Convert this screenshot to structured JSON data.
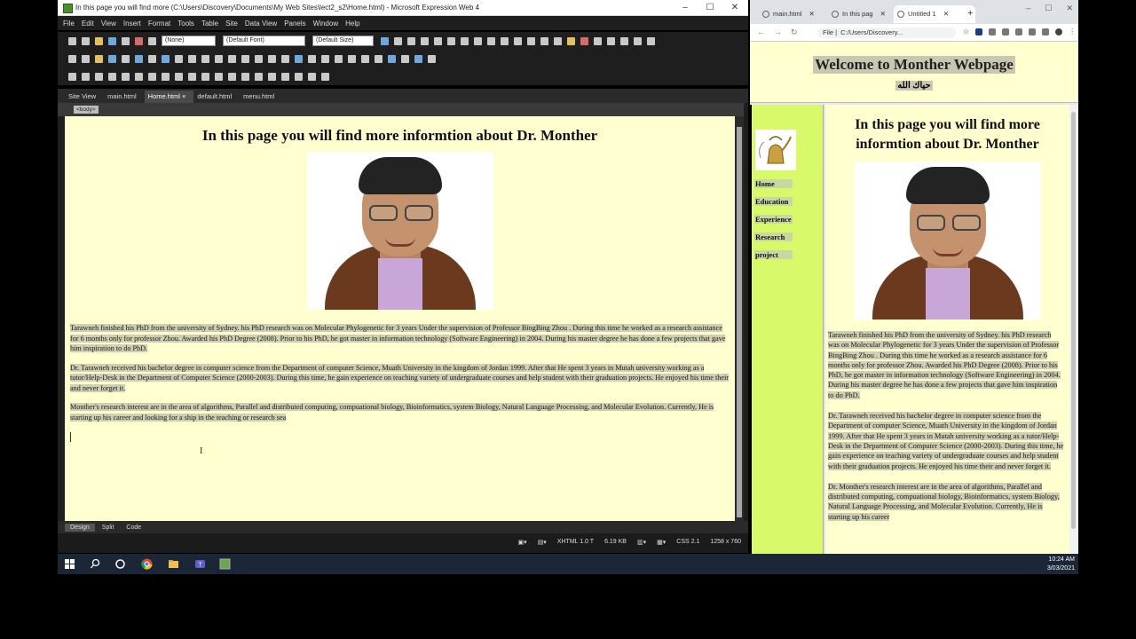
{
  "expression_web": {
    "title": "In this page you will find more (C:\\Users\\Discovery\\Documents\\My Web Sites\\lect2_s2\\Home.html) - Microsoft Expression Web 4",
    "window_controls": [
      "–",
      "☐",
      "✕"
    ],
    "menu": [
      "File",
      "Edit",
      "View",
      "Insert",
      "Format",
      "Tools",
      "Table",
      "Site",
      "Data View",
      "Panels",
      "Window",
      "Help"
    ],
    "toolbar": {
      "style_select": "(None)",
      "font_select": "(Default Font)",
      "size_select": "(Default Size)"
    },
    "tabs": [
      {
        "label": "Site View",
        "active": false
      },
      {
        "label": "main.html",
        "active": false
      },
      {
        "label": "Home.html ×",
        "active": true
      },
      {
        "label": "default.html",
        "active": false
      },
      {
        "label": "menu.html",
        "active": false
      }
    ],
    "breadcrumb_tag": "<body>",
    "document": {
      "heading": "In this page you will find more informtion about Dr. Monther",
      "paragraphs": [
        "Tarawneh finished his PhD from the university of Sydney. his PhD research was on Molecular Phylogenetic for 3 years Under the supervision of Professor BingBing Zhou . During this time he worked as a research assistance for 6 months only for professor Zhou. Awarded his PhD Degree (2008). Prior to his PhD, he got master in information technology (Software Engineering) in 2004. During his master degree he has done a few projects that gave him inspiration to do PhD.",
        "Dr. Tarawneh received his bachelor degree in computer science from the Department of computer Science, Muath University in the kingdom of Jordan 1999. After that He spent 3 years in Mutah university working as a tutor/Help-Desk in the Department of Computer Science (2000-2003). During this time, he gain experience on teaching variety of undergraduate courses and help student with their graduation projects. He enjoyed his time their and never forget it.",
        "Monther's research interest are in the area of algorithms, Parallel and distributed computing, compuational biology, Bioinformatics, system Biology, Natural Language Processing, and Molecular Evolution.  Currently, He is starting up his career and looking for a ship in the teaching or research sea"
      ]
    },
    "view_tabs": [
      {
        "label": "Design",
        "active": true
      },
      {
        "label": "Split",
        "active": false
      },
      {
        "label": "Code",
        "active": false
      }
    ],
    "status": {
      "doctype": "XHTML 1.0 T",
      "size": "6.19 KB",
      "css": "CSS 2.1",
      "dimensions": "1258 x 760"
    }
  },
  "chrome": {
    "tabs": [
      {
        "label": "main.html",
        "active": false
      },
      {
        "label": "In this pag",
        "active": false
      },
      {
        "label": "Untitled 1",
        "active": true
      }
    ],
    "new_tab": "+",
    "window_controls": [
      "–",
      "☐",
      "✕"
    ],
    "address": "C:/Users/Discovery...",
    "address_scheme": "File",
    "page": {
      "welcome": "Welcome to Monther Webpage",
      "arabic": "حياك الله",
      "nav_links": [
        "Home",
        "Education",
        "Experience",
        "Research",
        "project"
      ],
      "heading": "In this page you will find more informtion about Dr. Monther",
      "paragraphs": [
        "Tarawneh finished his PhD from the university of Sydney. his PhD research was on Molecular Phylogenetic for 3 years Under the supervision of Professor BingBing Zhou . During this time he worked as a research assistance for 6 months only for professor Zhou. Awarded his PhD Degree (2008). Prior to his PhD, he got master in information technology (Software Engineering) in 2004. During his master degree he has done a few projects that gave him inspiration to do PhD.",
        "Dr. Tarawneh received his bachelor degree in computer science from the Department of computer Science, Muath University in the kingdom of Jordan 1999. After that He spent 3 years in Mutah university working as a tutor/Help-Desk in the Department of Computer Science (2000-2003). During this time, he gain experience on teaching variety of undergraduate courses and help student with their graduation projects. He enjoyed his time their and never forget it.",
        "Dr. Monther's research interest are in the area of algorithms, Parallel and distributed computing, compuational biology, Bioinformatics, system Biology, Natural Language Processing, and Molecular Evolution.  Currently, He is starting up his career"
      ]
    }
  },
  "taskbar": {
    "time": "10:24 AM",
    "date": "3/03/2021"
  },
  "colors": {
    "page_bg": "#ffffd0",
    "nav_bg": "#d8fa6a",
    "highlight": "#cfcfb4"
  }
}
